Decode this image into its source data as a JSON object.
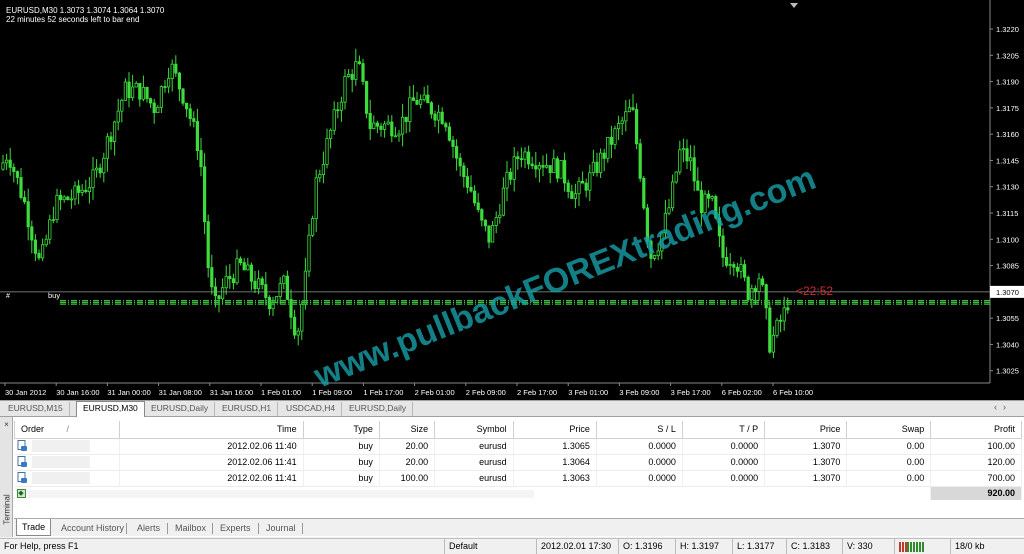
{
  "chart": {
    "header_line1": "EURUSD,M30  1.3073 1.3074 1.3064 1.3070",
    "header_line2": "22 minutes 52 seconds left to bar end",
    "price_ticks": [
      "1.3220",
      "1.3205",
      "1.3190",
      "1.3175",
      "1.3160",
      "1.3145",
      "1.3130",
      "1.3115",
      "1.3100",
      "1.3085",
      "1.3070",
      "1.3055",
      "1.3040",
      "1.3025"
    ],
    "time_ticks": [
      "30 Jan 2012",
      "30 Jan 16:00",
      "31 Jan 00:00",
      "31 Jan 08:00",
      "31 Jan 16:00",
      "1 Feb 01:00",
      "1 Feb 09:00",
      "1 Feb 17:00",
      "2 Feb 01:00",
      "2 Feb 09:00",
      "2 Feb 17:00",
      "3 Feb 01:00",
      "3 Feb 09:00",
      "3 Feb 17:00",
      "6 Feb 02:00",
      "6 Feb 10:00"
    ],
    "current_price": "1.3070",
    "countdown": "<22:52",
    "order_label": "buy",
    "order_marker": "#",
    "watermark": "www.pullbackFOREXtrading.com",
    "colors": {
      "bg": "#000000",
      "candle": "#3cdc3c",
      "axis_text": "#ffffff",
      "countdown": "#d22b2b",
      "order_line": "#3cbf3c",
      "watermark": "#16a0a8"
    }
  },
  "chart_tabs": [
    "EURUSD,M15",
    "EURUSD,M30",
    "EURUSD,Daily",
    "EURUSD,H1",
    "USDCAD,H4",
    "EURUSD,Daily"
  ],
  "chart_tabs_active": "EURUSD,M30",
  "terminal": {
    "side_label": "Terminal",
    "close_glyph": "×",
    "columns": [
      "Order",
      "Time",
      "Type",
      "Size",
      "Symbol",
      "Price",
      "S / L",
      "T / P",
      "Price",
      "Swap",
      "Profit"
    ],
    "order_sort_glyph": "/",
    "rows": [
      {
        "time": "2012.02.06 11:40",
        "type": "buy",
        "size": "20.00",
        "symbol": "eurusd",
        "price": "1.3065",
        "sl": "0.0000",
        "tp": "0.0000",
        "cur": "1.3070",
        "swap": "0.00",
        "profit": "100.00"
      },
      {
        "time": "2012.02.06 11:41",
        "type": "buy",
        "size": "20.00",
        "symbol": "eurusd",
        "price": "1.3064",
        "sl": "0.0000",
        "tp": "0.0000",
        "cur": "1.3070",
        "swap": "0.00",
        "profit": "120.00"
      },
      {
        "time": "2012.02.06 11:41",
        "type": "buy",
        "size": "100.00",
        "symbol": "eurusd",
        "price": "1.3063",
        "sl": "0.0000",
        "tp": "0.0000",
        "cur": "1.3070",
        "swap": "0.00",
        "profit": "700.00"
      }
    ],
    "total_profit": "920.00",
    "tabs": [
      "Trade",
      "Account History",
      "Alerts",
      "Mailbox",
      "Experts",
      "Journal"
    ],
    "active_tab": "Trade"
  },
  "status": {
    "help": "For Help, press F1",
    "profile": "Default",
    "datetime": "2012.02.01 17:30",
    "open": "O: 1.3196",
    "high": "H: 1.3197",
    "low": "L: 1.3177",
    "close": "C: 1.3183",
    "volume": "V: 330",
    "traffic": "18/0 kb"
  }
}
